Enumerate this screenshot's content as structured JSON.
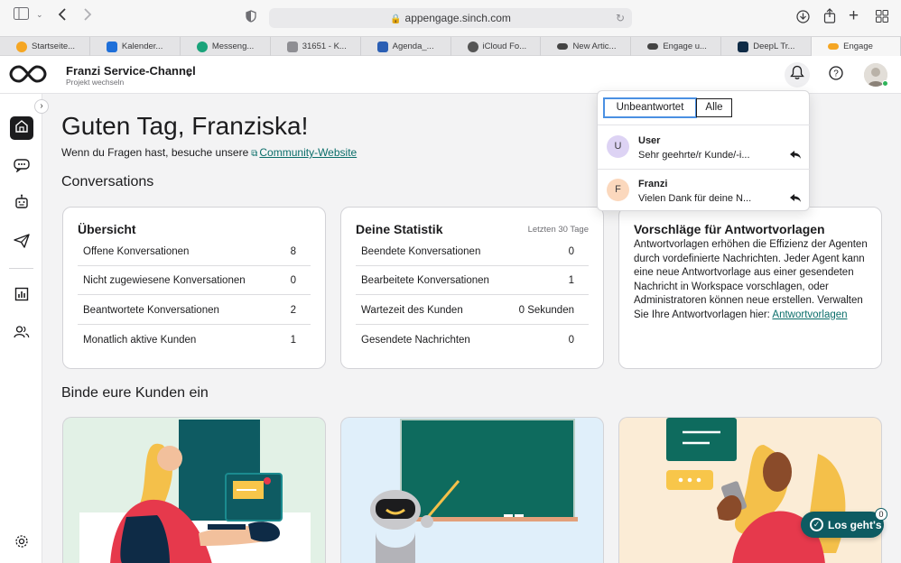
{
  "browser": {
    "url": "appengage.sinch.com",
    "tabs": [
      {
        "label": "Startseite...",
        "color": "#f5a623"
      },
      {
        "label": "Kalender...",
        "color": "#1e6fd9"
      },
      {
        "label": "Messeng...",
        "color": "#1aa37a"
      },
      {
        "label": "31651 - K...",
        "color": "#8e8e93"
      },
      {
        "label": "Agenda_...",
        "color": "#2b5fb4"
      },
      {
        "label": "iCloud Fo...",
        "color": "#555555"
      },
      {
        "label": "New Artic...",
        "color": "#444444"
      },
      {
        "label": "Engage u...",
        "color": "#444444"
      },
      {
        "label": "DeepL Tr...",
        "color": "#0f2b46"
      },
      {
        "label": "Engage",
        "color": "#f5a623"
      }
    ]
  },
  "header": {
    "project_title": "Franzi Service-Channel",
    "project_sub": "Projekt wechseln",
    "chevron": "⌄"
  },
  "main": {
    "greeting": "Guten Tag, Franziska!",
    "subline_prefix": "Wenn du Fragen hast, besuche unsere",
    "subline_link": "Community-Website",
    "conversations_title": "Conversations",
    "engage_title": "Binde eure Kunden ein"
  },
  "overview": {
    "title": "Übersicht",
    "rows": [
      {
        "label": "Offene Konversationen",
        "value": "8"
      },
      {
        "label": "Nicht zugewiesene Konversationen",
        "value": "0"
      },
      {
        "label": "Beantwortete Konversationen",
        "value": "2"
      },
      {
        "label": "Monatlich aktive Kunden",
        "value": "1"
      }
    ]
  },
  "stats": {
    "title": "Deine Statistik",
    "period": "Letzten 30 Tage",
    "rows": [
      {
        "label": "Beendete Konversationen",
        "value": "0"
      },
      {
        "label": "Bearbeitete Konversationen",
        "value": "1"
      },
      {
        "label": "Wartezeit des Kunden",
        "value": "0 Sekunden"
      },
      {
        "label": "Gesendete Nachrichten",
        "value": "0"
      }
    ]
  },
  "suggestions": {
    "title": "Vorschläge für Antwortvorlagen",
    "text": "Antwortvorlagen erhöhen die Effizienz der Agenten durch vordefinierte Nachrichten. Jeder Agent kann eine neue Antwortvorlage aus einer gesendeten Nachricht in Workspace vorschlagen, oder Administratoren können neue erstellen. Verwalten Sie Ihre Antwortvorlagen hier:",
    "link": "Antwortvorlagen"
  },
  "popover": {
    "tab_unanswered": "Unbeantwortet",
    "tab_all": "Alle",
    "items": [
      {
        "initial": "U",
        "name": "User",
        "message": "Sehr geehrte/r Kunde/-i...",
        "avatar_color": "#ddd3f4"
      },
      {
        "initial": "F",
        "name": "Franzi",
        "message": "Vielen Dank für deine N...",
        "avatar_color": "#fbd8bd"
      }
    ]
  },
  "cta": {
    "label": "Los geht's",
    "badge": "0"
  },
  "colors": {
    "accent": "#0b6e6a",
    "cta": "#0e5b62",
    "online": "#2fb45a"
  },
  "icons": {
    "sidebar": [
      "home-icon",
      "conversations-icon",
      "bot-icon",
      "campaigns-icon",
      "analytics-icon",
      "contacts-icon",
      "settings-icon"
    ]
  }
}
